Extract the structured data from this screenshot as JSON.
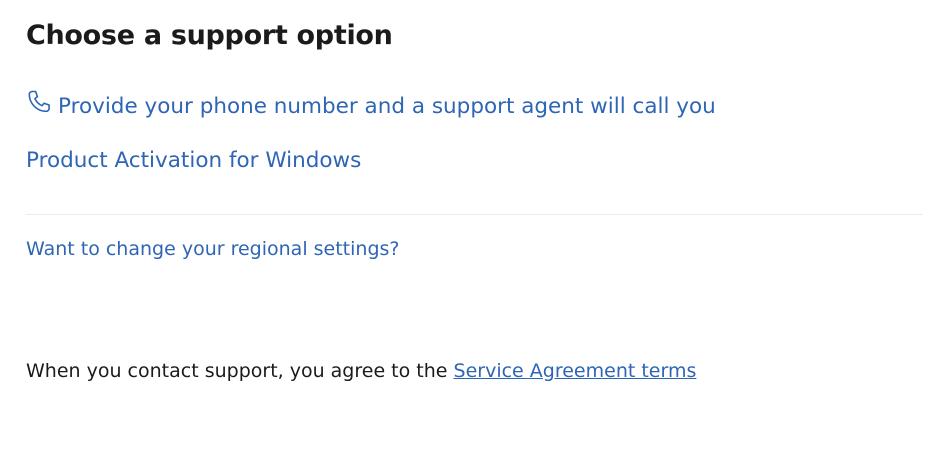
{
  "page": {
    "title": "Choose a support option"
  },
  "options": {
    "phone": {
      "label": "Provide your phone number and a support agent will call you",
      "icon": "phone-icon"
    },
    "activation": {
      "label": "Product Activation for Windows"
    }
  },
  "regional": {
    "label": "Want to change your regional settings?"
  },
  "agreement": {
    "text": "When you contact support, you agree to the",
    "link_label": "Service Agreement terms"
  },
  "colors": {
    "link": "#2e65b4",
    "text": "#1b1b1b",
    "divider": "#ebebeb"
  }
}
